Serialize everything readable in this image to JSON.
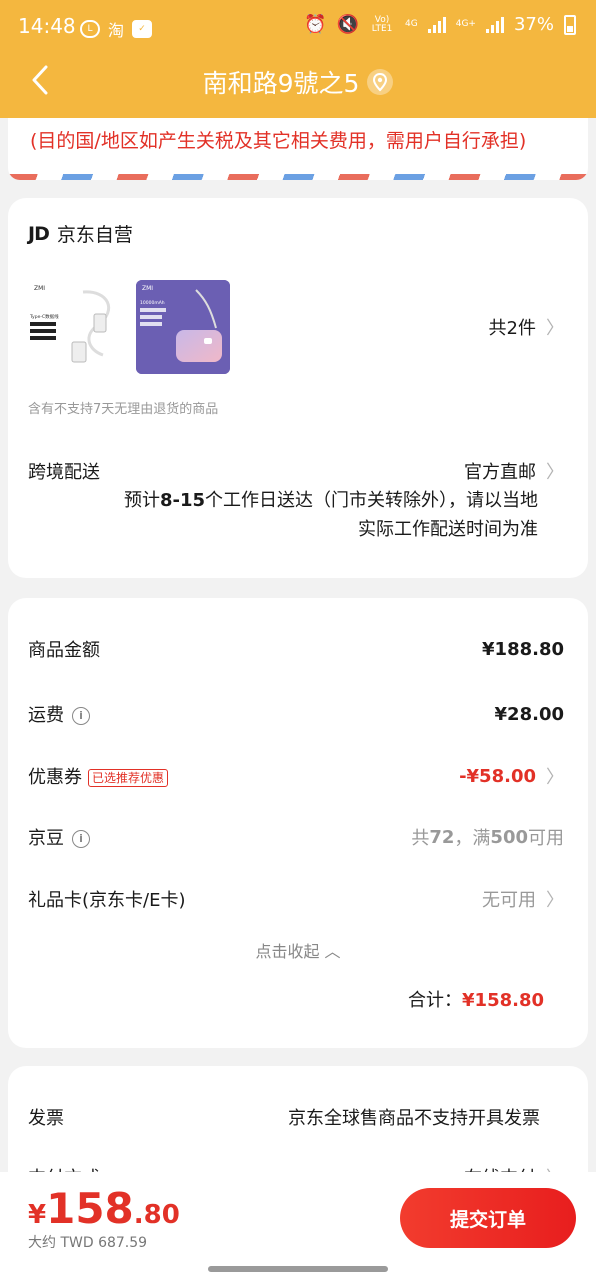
{
  "status_bar": {
    "time": "14:48",
    "left_icons": [
      "line-icon",
      "taobao-icon",
      "checkbox-icon"
    ],
    "network_label": "Vo) LTE1",
    "network_4g": "4G",
    "network_4g_plus": "4G+",
    "battery": "37%"
  },
  "header": {
    "title": "南和路9號之5",
    "back_icon": "chevron-left-icon",
    "location_icon": "location-pin-icon",
    "bg_color": "#f4b73f"
  },
  "notice": {
    "text": "(目的国/地区如产生关税及其它相关费用，需用户自行承担)",
    "color": "#e23127"
  },
  "shop": {
    "logo": "JD",
    "name": "京东自营"
  },
  "products": {
    "thumb1_brand": "ZMI",
    "thumb1_caption": "Type-C数据线",
    "thumb2_brand": "ZMI",
    "thumb2_caption": "10000mAh",
    "count": "共2件",
    "no_return_notice": "含有不支持7天无理由退货的商品"
  },
  "delivery": {
    "label": "跨境配送",
    "method": "官方直邮",
    "desc_prefix": "预计",
    "desc_days": "8-15",
    "desc_suffix": "个工作日送达（门市关转除外），请以当地实际工作配送时间为准"
  },
  "summary": {
    "goods_label": "商品金额",
    "goods_value": "¥188.80",
    "shipping_label": "运费",
    "shipping_value": "¥28.00",
    "coupon_label": "优惠券",
    "coupon_badge": "已选推荐优惠",
    "coupon_value": "-¥58.00",
    "jingdou_label": "京豆",
    "jingdou_value_prefix": "共",
    "jingdou_count": "72",
    "jingdou_value_mid": "，满",
    "jingdou_threshold": "500",
    "jingdou_value_suffix": "可用",
    "giftcard_label": "礼品卡(京东卡/E卡)",
    "giftcard_value": "无可用",
    "collapse_label": "点击收起",
    "total_label": "合计：",
    "total_value": "¥158.80"
  },
  "invoice": {
    "label": "发票",
    "value": "京东全球售商品不支持开具发票"
  },
  "payment": {
    "label": "支付方式",
    "value": "在线支付"
  },
  "bottom": {
    "currency": "¥",
    "price_int": "158",
    "price_dec": ".80",
    "approx": "大约 TWD 687.59",
    "submit_label": "提交订单",
    "accent": "#e23127"
  }
}
